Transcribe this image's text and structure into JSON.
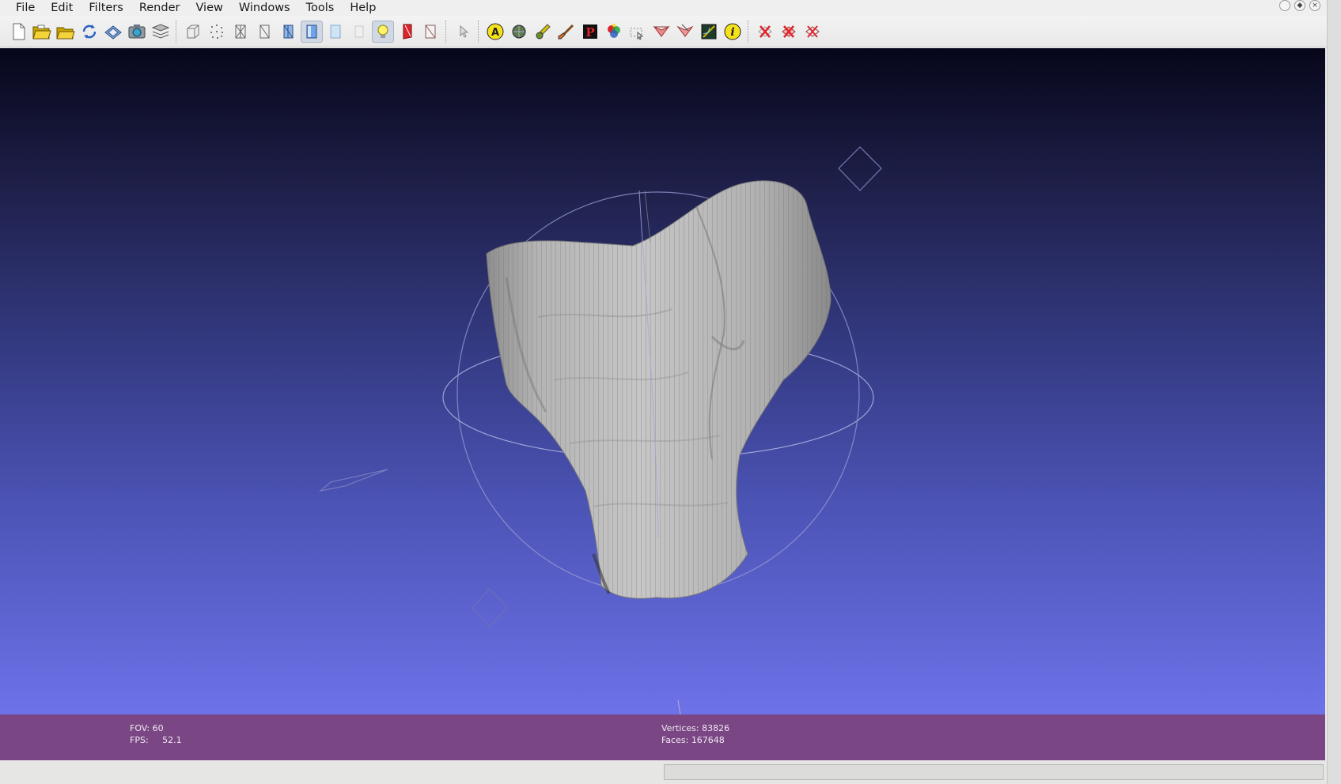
{
  "menu": {
    "file": "File",
    "edit": "Edit",
    "filters": "Filters",
    "render": "Render",
    "view": "View",
    "windows": "Windows",
    "tools": "Tools",
    "help": "Help"
  },
  "toolbar": {
    "icons": [
      "new-project-icon",
      "open-project-icon",
      "import-mesh-icon",
      "reload-icon",
      "save-icon",
      "snapshot-icon",
      "layers-icon",
      "bounding-box-icon",
      "points-icon",
      "wireframe-icon",
      "hidden-lines-icon",
      "flat-lines-icon",
      "smooth-icon",
      "texture-icon",
      "lighting-icon",
      "backface-icon",
      "double-side-icon",
      "select-icon",
      "align-icon",
      "measure-icon",
      "paint-icon",
      "brush-icon",
      "pick-points-icon",
      "color-icon",
      "select-faces-icon",
      "select-vertices-icon",
      "edit-reference-icon",
      "image-align-icon",
      "info-icon",
      "delete-faces-icon",
      "delete-vertices-icon",
      "delete-selection-icon"
    ],
    "colors": {
      "active_bg": "#cfd8e3",
      "yellow": "#f2e01a",
      "red": "#e0242c"
    }
  },
  "viewport": {
    "background_top": "#06061a",
    "background_bottom": "#6d72e8",
    "mesh_color": "#b9b9b9",
    "trackball_color": "#9a9fd6"
  },
  "info": {
    "fov_label": "FOV:",
    "fov_value": "60",
    "fps_label": "FPS:",
    "fps_value": "52.1",
    "vertices_label": "Vertices:",
    "vertices_value": "83826",
    "faces_label": "Faces:",
    "faces_value": "167648",
    "bar_color": "#7a4784"
  }
}
